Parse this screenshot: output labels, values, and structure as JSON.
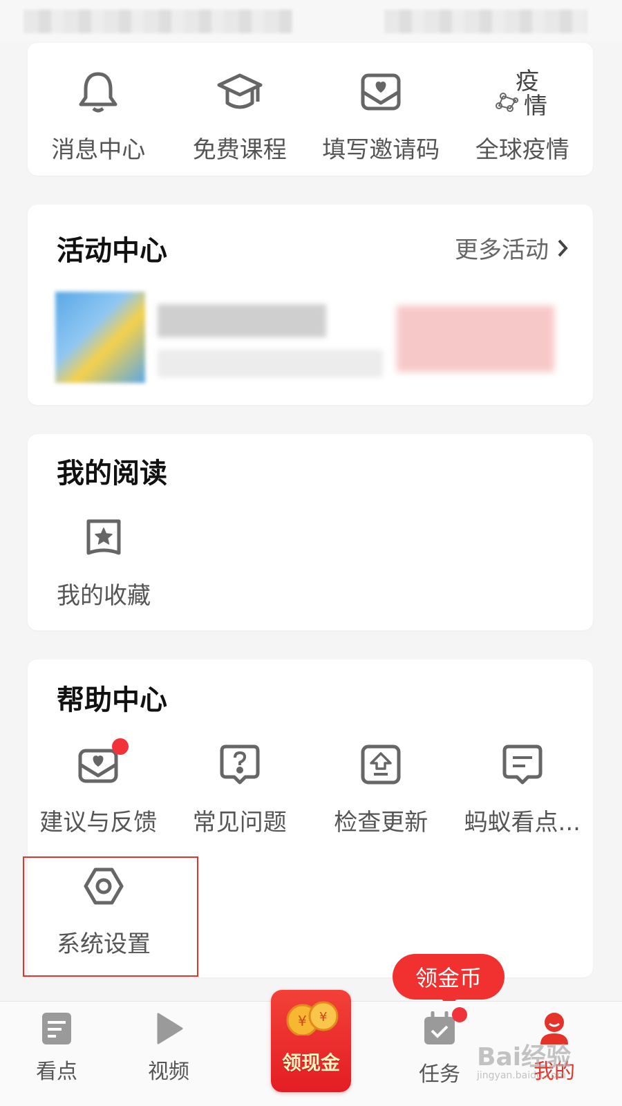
{
  "quick_links": [
    {
      "label": "消息中心",
      "icon": "bell-icon"
    },
    {
      "label": "免费课程",
      "icon": "graduation-cap-icon"
    },
    {
      "label": "填写邀请码",
      "icon": "invite-envelope-icon"
    },
    {
      "label": "全球疫情",
      "icon": "epidemic-icon"
    }
  ],
  "epidemic_icon_text": {
    "top": "疫",
    "bottom": "情"
  },
  "activity": {
    "title": "活动中心",
    "more_label": "更多活动"
  },
  "reading": {
    "title": "我的阅读",
    "items": [
      {
        "label": "我的收藏",
        "icon": "star-bookmark-icon"
      }
    ]
  },
  "help": {
    "title": "帮助中心",
    "items": [
      {
        "label": "建议与反馈",
        "icon": "feedback-envelope-icon",
        "badge": true
      },
      {
        "label": "常见问题",
        "icon": "question-bubble-icon"
      },
      {
        "label": "检查更新",
        "icon": "update-arrow-icon"
      },
      {
        "label": "蚂蚁看点...",
        "icon": "message-bubble-icon"
      },
      {
        "label": "系统设置",
        "icon": "settings-hexagon-icon"
      }
    ]
  },
  "bubble": {
    "label": "领金币"
  },
  "cash_button": {
    "label": "领现金"
  },
  "tabs": [
    {
      "label": "看点",
      "icon": "article-icon"
    },
    {
      "label": "视频",
      "icon": "play-icon"
    },
    {
      "label": "任务",
      "icon": "calendar-check-icon",
      "badge": true
    },
    {
      "label": "我的",
      "icon": "profile-icon",
      "active": true
    }
  ],
  "watermark": {
    "brand": "Bai经验",
    "url": "jingyan.baidu.com"
  },
  "colors": {
    "accent": "#e6332a",
    "icon_gray": "#666666",
    "background": "#f5f5f5"
  }
}
